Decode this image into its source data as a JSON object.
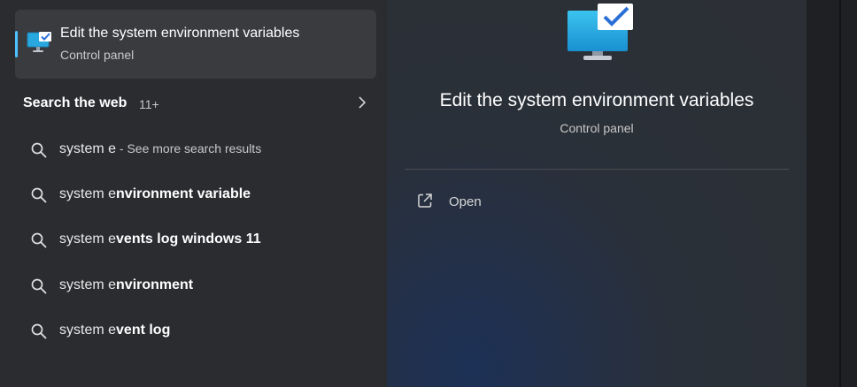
{
  "best_match": {
    "title": "Edit the system environment variables",
    "subtitle": "Control panel",
    "icon": "control-panel-monitor-icon"
  },
  "web_section": {
    "title": "Search the web",
    "count": "11+"
  },
  "web_results": [
    {
      "prefix": "system e",
      "bold": "",
      "suffix": " - See more search results"
    },
    {
      "prefix": "system e",
      "bold": "nvironment variable",
      "suffix": ""
    },
    {
      "prefix": "system e",
      "bold": "vents log windows 11",
      "suffix": ""
    },
    {
      "prefix": "system e",
      "bold": "nvironment",
      "suffix": ""
    },
    {
      "prefix": "system e",
      "bold": "vent log",
      "suffix": ""
    }
  ],
  "detail": {
    "title": "Edit the system environment variables",
    "subtitle": "Control panel",
    "actions": [
      {
        "label": "Open",
        "icon": "open-external-icon"
      }
    ]
  },
  "colors": {
    "accent": "#4cc2ff",
    "left_pane": "#2b2c30",
    "selected_item": "#3a3b3f"
  }
}
